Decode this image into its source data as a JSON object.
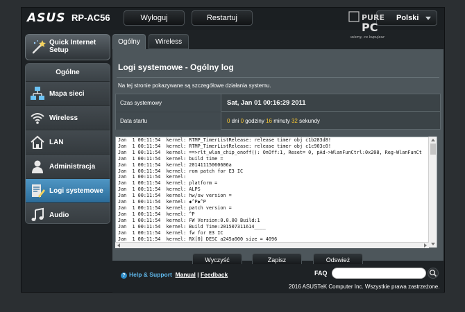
{
  "header": {
    "brand": "ASUS",
    "model": "RP-AC56",
    "logout_label": "Wyloguj",
    "restart_label": "Restartuj",
    "language": "Polski",
    "watermark": "purepc"
  },
  "sidebar": {
    "quick_setup_label": "Quick Internet Setup",
    "section_label": "Ogólne",
    "items": [
      {
        "label": "Mapa sieci",
        "icon": "network-map-icon",
        "active": false
      },
      {
        "label": "Wireless",
        "icon": "wireless-icon",
        "active": false
      },
      {
        "label": "LAN",
        "icon": "home-icon",
        "active": false
      },
      {
        "label": "Administracja",
        "icon": "person-icon",
        "active": false
      },
      {
        "label": "Logi systemowe",
        "icon": "log-icon",
        "active": true
      },
      {
        "label": "Audio",
        "icon": "music-note-icon",
        "active": false
      }
    ]
  },
  "tabs": [
    {
      "label": "Ogólny log",
      "active": true
    },
    {
      "label": "Wireless Log",
      "active": false
    }
  ],
  "main": {
    "title": "Logi systemowe - Ogólny log",
    "description": "Na tej stronie pokazywane są szczegółowe działania systemu.",
    "system_time_label": "Czas systemowy",
    "system_time_value": "Sat, Jan 01  00:16:29  2011",
    "uptime_label": "Data startu",
    "uptime": {
      "days": "0",
      "days_text": " dni ",
      "hours": "0",
      "hours_text": " godziny ",
      "minutes": "16",
      "minutes_text": " minuty ",
      "seconds": "32",
      "seconds_text": " sekundy"
    },
    "log_lines": [
      "Jan  1 00:11:54  kernel: RTMP_TimerListRelease: release timer obj c1b283d8!",
      "Jan  1 00:11:54  kernel: RTMP_TimerListRelease: release timer obj c1c903c0!",
      "Jan  1 00:11:54  kernel: ==>rlt_wlan_chip_onoff(): OnOff:1, Reset= 0, pAd->WlanFunCtrl:0x208, Reg-WlanFunCt",
      "Jan  1 00:11:54  kernel: build time =",
      "Jan  1 00:11:54  kernel: 20141115060606a",
      "Jan  1 00:11:54  kernel: rom patch for E3 IC",
      "Jan  1 00:11:54  kernel:",
      "Jan  1 00:11:54  kernel: platform =",
      "Jan  1 00:11:54  kernel: ALPS",
      "Jan  1 00:11:54  kernel: hw/sw version =",
      "Jan  1 00:11:54  kernel: ◆^P◆^P",
      "Jan  1 00:11:54  kernel: patch version =",
      "Jan  1 00:11:54  kernel: ^P",
      "Jan  1 00:11:54  kernel: FW Version:0.0.00 Build:1",
      "Jan  1 00:11:54  kernel: Build Time:201507311614____",
      "Jan  1 00:11:54  kernel: fw for E3 IC",
      "Jan  1 00:11:54  kernel: RX[0] DESC a245a000 size = 4096"
    ]
  },
  "actions": {
    "clear_label": "Wyczyść",
    "save_label": "Zapisz",
    "refresh_label": "Odswież"
  },
  "footer": {
    "help_label": "Help & Support",
    "manual_label": "Manual",
    "separator": " | ",
    "feedback_label": "Feedback",
    "faq_label": "FAQ",
    "copyright": "2016 ASUSTeK Computer Inc. Wszystkie prawa zastrzeżone."
  },
  "colors": {
    "accent": "#2b6c9a",
    "highlight": "#ffcc33",
    "panel": "#4d565b"
  }
}
